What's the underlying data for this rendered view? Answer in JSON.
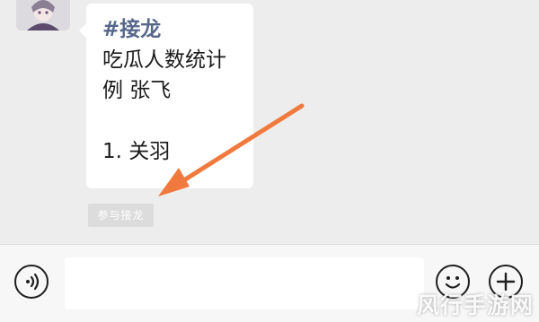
{
  "message": {
    "tag": "#接龙",
    "lines": [
      "吃瓜人数统计",
      "例 张飞",
      "",
      "1. 关羽"
    ]
  },
  "join_button": {
    "label": "参与接龙"
  },
  "input_bar": {
    "text_value": "",
    "voice_icon": "voice-icon",
    "emoji_icon": "emoji-icon",
    "plus_icon": "plus-icon"
  },
  "watermark": {
    "text": "风行手游网"
  },
  "colors": {
    "tag": "#56678a",
    "arrow": "#f07a3e",
    "chat_bg": "#ededed"
  }
}
